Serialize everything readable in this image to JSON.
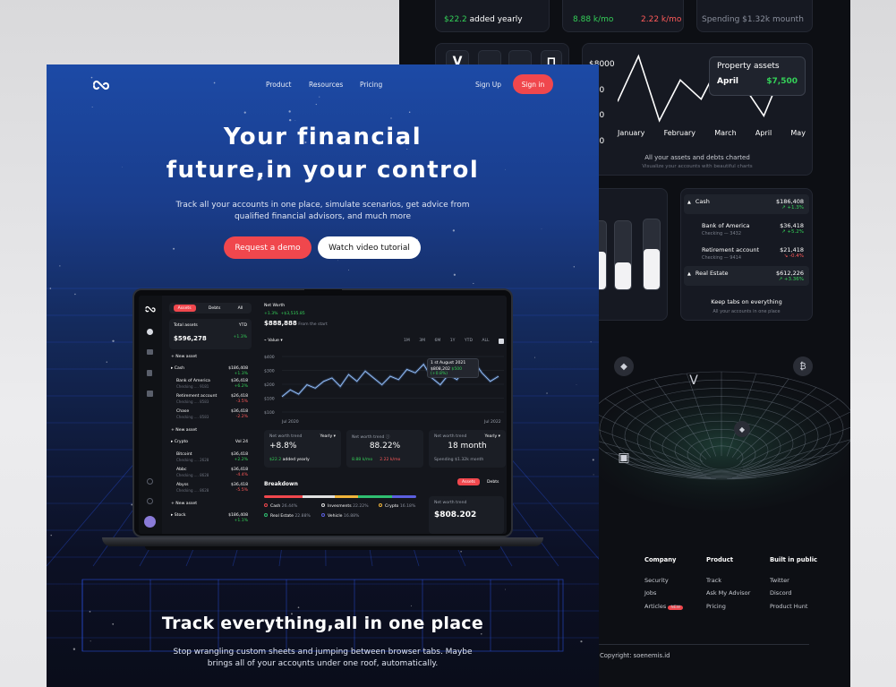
{
  "back": {
    "kpis": {
      "added": "$22.2",
      "added_suffix": "added yearly",
      "k_green": "8.88 k/mo",
      "k_red": "2.22 k/mo",
      "spending": "Spending $1.32k mounth"
    },
    "chart_data": {
      "type": "line",
      "x": [
        "January",
        "February",
        "March",
        "April",
        "May"
      ],
      "y_ticks": [
        "$8000",
        "000",
        "000",
        "000"
      ],
      "values": [
        6000,
        7900,
        5200,
        6900,
        6100,
        7800,
        6700,
        5400,
        7500,
        6600
      ],
      "tooltip": {
        "title": "Property assets",
        "month": "April",
        "value": "$7,500"
      },
      "caption": "All your assets and debts charted",
      "subcaption": "Visualize your accounts with beautiful charts"
    },
    "bars": [
      0.55,
      0.4,
      0.58
    ],
    "accounts": [
      {
        "name": "Cash",
        "value": "$186,408",
        "change": "+1.3%",
        "dir": "up",
        "group": true
      },
      {
        "name": "Bank of America",
        "sub": "Checking — 3432",
        "value": "$36,418",
        "change": "+5.2%",
        "dir": "up"
      },
      {
        "name": "Retirement account",
        "sub": "Checking — 9414",
        "value": "$21,418",
        "change": "-0.4%",
        "dir": "down"
      },
      {
        "name": "Real Estate",
        "value": "$612,226",
        "change": "+3.36%",
        "dir": "up",
        "group": true
      }
    ],
    "keep_tabs": "Keep tabs on everything",
    "keep_tabs_sub": "All your accounts in one place",
    "footer": {
      "company": {
        "title": "Company",
        "items": [
          "Security",
          "Jobs",
          "Articles"
        ],
        "badge": "NEW"
      },
      "product": {
        "title": "Product",
        "items": [
          "Track",
          "Ask My Advisor",
          "Pricing"
        ]
      },
      "public": {
        "title": "Built in public",
        "items": [
          "Twitter",
          "Discord",
          "Product Hunt"
        ]
      },
      "copyright": "Copyright: soenemis.id"
    }
  },
  "front": {
    "nav": {
      "product": "Product",
      "resources": "Resources",
      "pricing": "Pricing",
      "signup": "Sign Up",
      "signin": "Sign in"
    },
    "hero_line1": "Your financial",
    "hero_line2": "future,in your control",
    "hero_sub1": "Track all your accounts in one place, simulate scenarios, get advice from",
    "hero_sub2": "qualified financial advisors, and much more",
    "cta_demo": "Request a demo",
    "cta_video": "Watch video tutorial",
    "section_title": "Track everything,all in one place",
    "section_sub1": "Stop wrangling custom sheets and jumping between browser tabs. Maybe",
    "section_sub2": "brings all of your accounts under one roof, automatically."
  },
  "screen": {
    "tabs": [
      "Assets",
      "Debts",
      "All"
    ],
    "total_label": "Total assets",
    "period": "YTD",
    "total": "$596,278",
    "total_change": "+1.3%",
    "new_asset": "New asset",
    "groups": [
      {
        "name": "Cash",
        "value": "$186,408",
        "change": "+1.3%",
        "items": [
          {
            "n": "Bank of America",
            "s": "Checking .... 9181",
            "v": "$36,418",
            "c": "+6.2%"
          },
          {
            "n": "Retirement account",
            "s": "Checking .... 8583",
            "v": "$26,418",
            "c": "-3.5%"
          },
          {
            "n": "Chase",
            "s": "Checking .... 8583",
            "v": "$36,418",
            "c": "-2.2%"
          }
        ]
      },
      {
        "name": "Crypto",
        "value": "Vol 24",
        "items": [
          {
            "n": "Bitcoint",
            "s": "Checking .... 2628",
            "v": "$36,418",
            "c": "+2.2%"
          },
          {
            "n": "Abbc",
            "s": "Checking .... 8628",
            "v": "$36,418",
            "c": "-4.4%"
          },
          {
            "n": "Abyss",
            "s": "Checking .... 8628",
            "v": "$36,418",
            "c": "-5.5%"
          }
        ]
      },
      {
        "name": "Stock",
        "value": "$186,408",
        "change": "+1.1%",
        "items": []
      }
    ],
    "net_worth": "Net Worth",
    "nw_change": "+1.3%",
    "nw_abs": "+$3,535.85",
    "nw_value": "$888,888",
    "nw_from": "From the start",
    "value_label": "Value",
    "ranges": [
      "1M",
      "3M",
      "6M",
      "1Y",
      "YTD",
      "ALL"
    ],
    "chart_data": {
      "type": "line",
      "y_ticks": [
        "$400",
        "$300",
        "$200",
        "$100",
        "$100"
      ],
      "x_start": "Jul 2020",
      "x_end": "Jul 2022",
      "values": [
        190,
        230,
        205,
        260,
        240,
        280,
        300,
        250,
        320,
        280,
        340,
        300,
        260,
        310,
        290,
        350,
        330,
        380,
        300,
        260,
        320,
        290,
        360,
        400,
        330,
        280,
        310
      ],
      "tip_date": "1 st August 2021",
      "tip_value": "$808,202",
      "tip_change": "$500 (+0.8%)"
    },
    "cards": [
      {
        "label": "Net worth trend",
        "period": "Yearly",
        "value": "+8.8%",
        "foot": "$22.2 added yearly"
      },
      {
        "label": "Net worth trend",
        "value": "88.22%",
        "foot_g": "8.88 k/mo",
        "foot_r": "2.22 k/mo"
      },
      {
        "label": "Net worth trend",
        "period": "Yearly",
        "value": "18 month",
        "foot": "Spending $1.32k month"
      }
    ],
    "breakdown": "Breakdown",
    "bd_tabs": [
      "Assets",
      "Debts"
    ],
    "bd_items": [
      {
        "name": "Cash",
        "pct": "26.44%",
        "color": "#f0474d"
      },
      {
        "name": "Invesments",
        "pct": "22.22%",
        "color": "#e0e0e0"
      },
      {
        "name": "Crypto",
        "pct": "16.18%",
        "color": "#f0b43a"
      },
      {
        "name": "Real Estate",
        "pct": "22.88%",
        "color": "#2fbf71"
      },
      {
        "name": "Vehicle",
        "pct": "16.88%",
        "color": "#5b5fe0"
      }
    ],
    "bd_card_label": "Net worth trend",
    "bd_card_value": "$808.202"
  },
  "colors": {
    "accent": "#f0474d",
    "green": "#34d058",
    "red": "#ff5a5a"
  }
}
